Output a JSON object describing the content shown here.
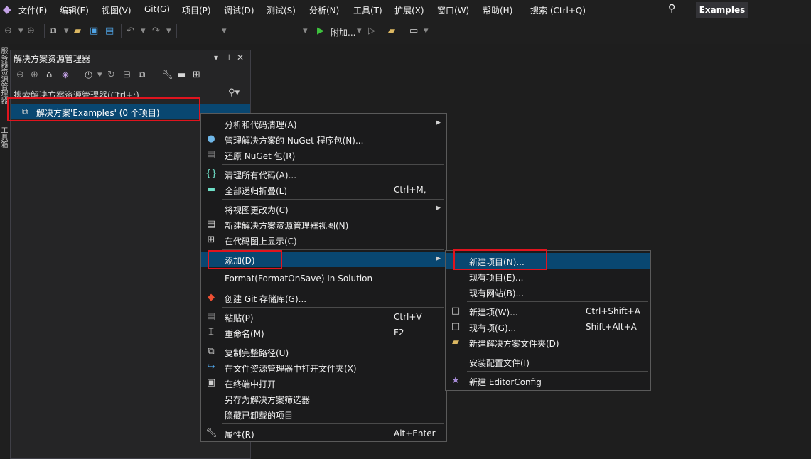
{
  "menubar": {
    "items": [
      "文件(F)",
      "编辑(E)",
      "视图(V)",
      "Git(G)",
      "项目(P)",
      "调试(D)",
      "测试(S)",
      "分析(N)",
      "工具(T)",
      "扩展(X)",
      "窗口(W)",
      "帮助(H)"
    ],
    "search_label": "搜索 (Ctrl+Q)",
    "solution_tab": "Examples"
  },
  "toolbar": {
    "attach_label": "附加...",
    "icons": [
      "back-icon",
      "forward-icon",
      "new-project-icon",
      "open-icon",
      "save-icon",
      "save-all-icon",
      "undo-icon",
      "redo-icon",
      "start-icon",
      "run-icon",
      "folder-icon",
      "layout-icon"
    ]
  },
  "left_tabs": [
    "服务器资源管理器",
    "工具箱"
  ],
  "solution_explorer": {
    "title": "解决方案资源管理器",
    "search_placeholder": "搜索解决方案资源管理器(Ctrl+;)",
    "root_item": "解决方案'Examples' (0 个项目)"
  },
  "context_menu": {
    "items": [
      {
        "label": "分析和代码清理(A)",
        "has_submenu": true
      },
      {
        "label": "管理解决方案的 NuGet 程序包(N)...",
        "icon": "nuget-icon"
      },
      {
        "label": "还原 NuGet 包(R)",
        "icon": "restore-icon"
      },
      {
        "label": "清理所有代码(A)...",
        "icon": "code-cleanup-icon"
      },
      {
        "label": "全部递归折叠(L)",
        "shortcut": "Ctrl+M, -",
        "icon": "collapse-icon"
      },
      {
        "label": "将视图更改为(C)",
        "has_submenu": true
      },
      {
        "label": "新建解决方案资源管理器视图(N)",
        "icon": "new-view-icon"
      },
      {
        "label": "在代码图上显示(C)",
        "icon": "code-map-icon"
      },
      {
        "label": "添加(D)",
        "has_submenu": true,
        "highlighted": true
      },
      {
        "label": "Format(FormatOnSave) In Solution"
      },
      {
        "label": "创建 Git 存储库(G)...",
        "icon": "git-repo-icon"
      },
      {
        "label": "粘贴(P)",
        "shortcut": "Ctrl+V",
        "icon": "paste-icon"
      },
      {
        "label": "重命名(M)",
        "shortcut": "F2",
        "icon": "rename-icon"
      },
      {
        "label": "复制完整路径(U)",
        "icon": "copy-path-icon"
      },
      {
        "label": "在文件资源管理器中打开文件夹(X)",
        "icon": "open-folder-icon"
      },
      {
        "label": "在终端中打开",
        "icon": "terminal-icon"
      },
      {
        "label": "另存为解决方案筛选器"
      },
      {
        "label": "隐藏已卸载的项目"
      },
      {
        "label": "属性(R)",
        "shortcut": "Alt+Enter",
        "icon": "wrench-icon"
      }
    ]
  },
  "submenu": {
    "items": [
      {
        "label": "新建项目(N)...",
        "highlighted": true
      },
      {
        "label": "现有项目(E)..."
      },
      {
        "label": "现有网站(B)..."
      },
      {
        "label": "新建项(W)...",
        "shortcut": "Ctrl+Shift+A",
        "icon": "new-item-icon"
      },
      {
        "label": "现有项(G)...",
        "shortcut": "Shift+Alt+A",
        "icon": "existing-item-icon"
      },
      {
        "label": "新建解决方案文件夹(D)",
        "icon": "new-folder-icon"
      },
      {
        "label": "安装配置文件(I)"
      },
      {
        "label": "新建 EditorConfig",
        "icon": "editorconfig-icon"
      }
    ]
  },
  "colors": {
    "background": "#1e1e1e",
    "menu_bg": "#1b1b1c",
    "highlight": "#094771",
    "annotation_red": "#e0141e",
    "accent_purple": "#c5a3e8"
  }
}
